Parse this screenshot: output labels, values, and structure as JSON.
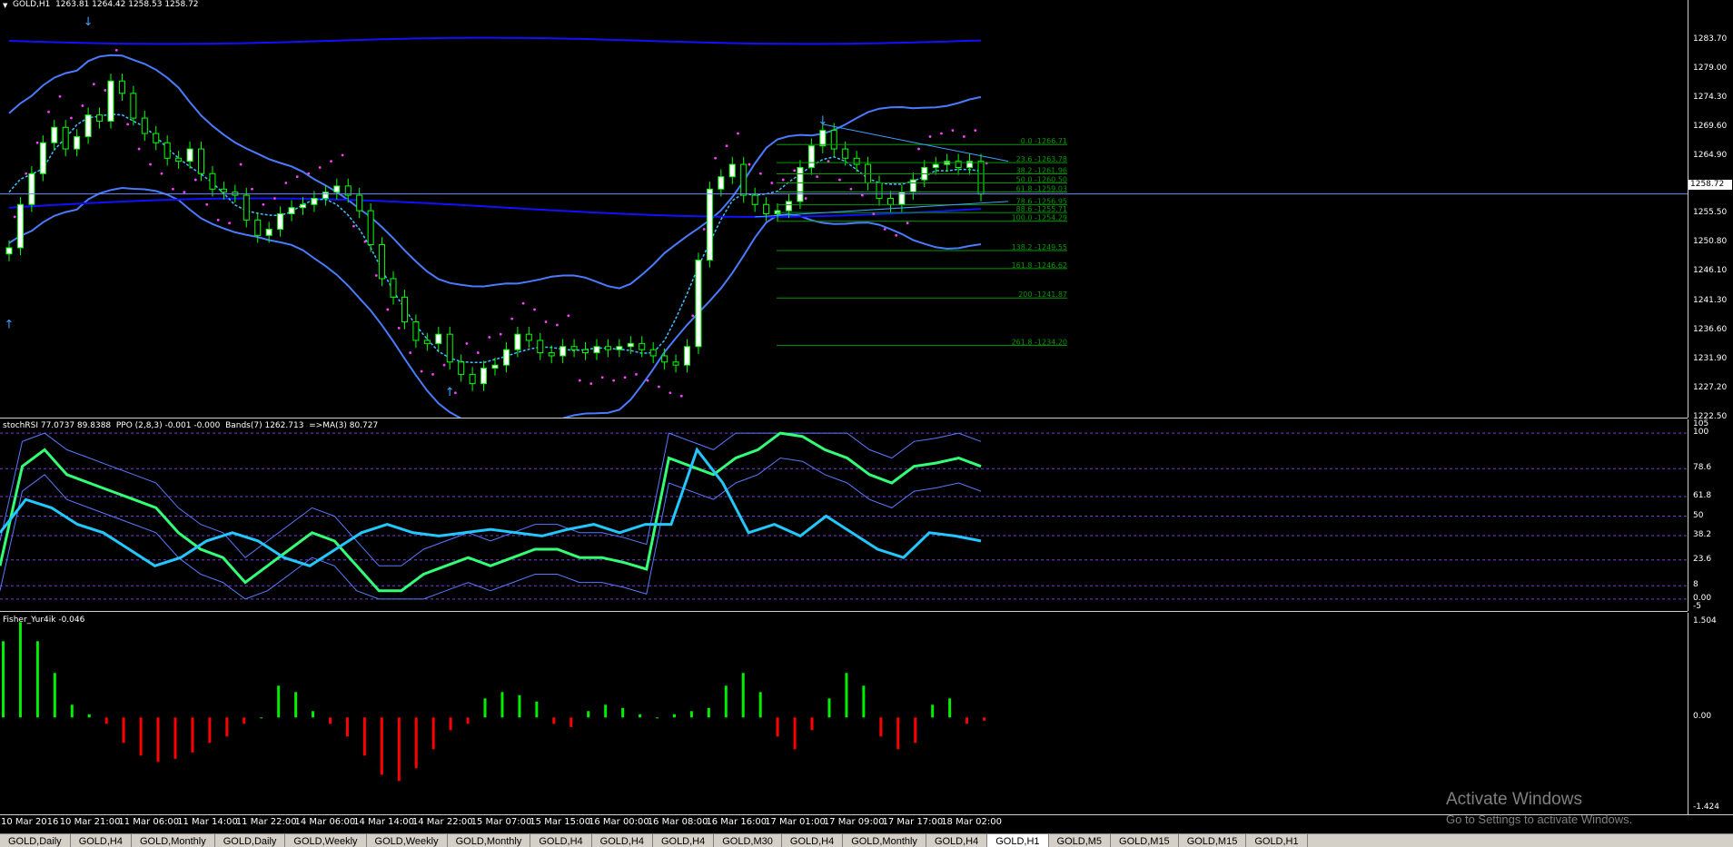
{
  "main_pane": {
    "label": "GOLD,H1  1263.81 1264.42 1258.53 1258.72",
    "price_tag": "1258.72",
    "ylim": [
      1222.5,
      1286.0
    ],
    "yticks": [
      "1283.70",
      "1279.00",
      "1274.30",
      "1269.60",
      "1264.90",
      "1260.20",
      "1255.50",
      "1250.80",
      "1246.10",
      "1241.30",
      "1236.60",
      "1231.90",
      "1227.20",
      "1222.50"
    ]
  },
  "stoch_pane": {
    "label": "stochRSI 77.0737 89.8388  PPO (2,8,3) -0.001 -0.000  Bands(7) 1262.713  =>MA(3) 80.727",
    "yticks": [
      "105",
      "100",
      "78.6",
      "61.8",
      "50",
      "38.2",
      "23.6",
      "8",
      "0.00",
      "-5"
    ]
  },
  "fisher_pane": {
    "label": "Fisher_Yur4ik -0.046",
    "yticks": [
      "1.504",
      "0.00",
      "-1.424"
    ]
  },
  "fib_levels": [
    {
      "label": "0.0 -1266.71",
      "value": 1266.71
    },
    {
      "label": "23.6 -1263.78",
      "value": 1263.78
    },
    {
      "label": "38.2 -1261.96",
      "value": 1261.96
    },
    {
      "label": "50.0 -1260.50",
      "value": 1260.5
    },
    {
      "label": "61.8 -1259.03",
      "value": 1259.03
    },
    {
      "label": "78.6 -1256.95",
      "value": 1256.95
    },
    {
      "label": "88.6 -1255.71",
      "value": 1255.71
    },
    {
      "label": "100.0 -1254.29",
      "value": 1254.29
    },
    {
      "label": "138.2 -1249.55",
      "value": 1249.55
    },
    {
      "label": "161.8 -1246.62",
      "value": 1246.62
    },
    {
      "label": "200 -1241.87",
      "value": 1241.87
    },
    {
      "label": "261.8 -1234.20",
      "value": 1234.2
    }
  ],
  "time_axis": [
    "10 Mar 2016",
    "10 Mar 21:00",
    "11 Mar 06:00",
    "11 Mar 14:00",
    "11 Mar 22:00",
    "14 Mar 06:00",
    "14 Mar 14:00",
    "14 Mar 22:00",
    "15 Mar 07:00",
    "15 Mar 15:00",
    "16 Mar 00:00",
    "16 Mar 08:00",
    "16 Mar 16:00",
    "17 Mar 01:00",
    "17 Mar 09:00",
    "17 Mar 17:00",
    "18 Mar 02:00"
  ],
  "tabs": [
    "GOLD,Daily",
    "GOLD,H4",
    "GOLD,Monthly",
    "GOLD,Daily",
    "GOLD,Weekly",
    "GOLD,Weekly",
    "GOLD,Monthly",
    "GOLD,H4",
    "GOLD,H4",
    "GOLD,H4",
    "GOLD,M30",
    "GOLD,H4",
    "GOLD,Monthly",
    "GOLD,H4",
    "GOLD,H1",
    "GOLD,M5",
    "GOLD,M15",
    "GOLD,M15",
    "GOLD,H1"
  ],
  "active_tab_index": 14,
  "watermark": {
    "title": "Activate Windows",
    "subtitle": "Go to Settings to activate Windows."
  },
  "colors": {
    "bull_candle": "#ffffff",
    "bear_candle": "#000000",
    "wick": "#00ff00",
    "bands": "#4a7bff",
    "band_mid": "#1010ff",
    "sar": "#ff40ff",
    "ma_fast": "#44c0ff",
    "fib": "#009900",
    "trend": "#40a0ff",
    "stoch_green": "#33ff77",
    "stoch_cyan": "#22c8ff",
    "fisher_up": "#00ee00",
    "fisher_down": "#ff0000",
    "dotted_level": "#7a3bd8"
  },
  "chart_data": {
    "type": "line",
    "title": "GOLD,H1",
    "close": [
      1250.0,
      1257.0,
      1262.0,
      1267.0,
      1269.5,
      1266.0,
      1268.0,
      1271.5,
      1270.5,
      1277.0,
      1275.0,
      1271.0,
      1268.5,
      1267.0,
      1264.5,
      1264.0,
      1266.0,
      1262.0,
      1259.5,
      1259.0,
      1258.5,
      1254.5,
      1252.0,
      1253.0,
      1255.5,
      1256.5,
      1257.0,
      1258.0,
      1259.0,
      1260.0,
      1258.5,
      1256.0,
      1250.5,
      1245.0,
      1242.0,
      1238.0,
      1235.0,
      1234.5,
      1236.0,
      1231.5,
      1229.5,
      1228.0,
      1230.5,
      1231.0,
      1233.5,
      1236.0,
      1235.0,
      1233.0,
      1232.5,
      1234.0,
      1233.5,
      1233.0,
      1234.0,
      1233.5,
      1234.0,
      1234.5,
      1233.5,
      1232.5,
      1231.5,
      1231.0,
      1234.0,
      1248.0,
      1259.5,
      1261.5,
      1263.5,
      1258.5,
      1257.0,
      1255.5,
      1256.0,
      1257.5,
      1263.0,
      1266.5,
      1269.0,
      1266.0,
      1264.5,
      1263.5,
      1260.5,
      1258.0,
      1257.0,
      1259.0,
      1261.0,
      1263.0,
      1263.5,
      1264.0,
      1263.0,
      1264.0,
      1258.7
    ],
    "stoch_rsi": [
      20,
      80,
      90,
      75,
      70,
      65,
      60,
      55,
      40,
      30,
      25,
      10,
      20,
      30,
      40,
      35,
      20,
      5,
      5,
      15,
      20,
      25,
      20,
      25,
      30,
      30,
      25,
      25,
      22,
      18,
      85,
      80,
      75,
      85,
      90,
      100,
      98,
      90,
      85,
      75,
      70,
      80,
      82,
      85,
      80
    ],
    "ppo_line": [
      40,
      60,
      55,
      45,
      40,
      30,
      20,
      25,
      35,
      40,
      35,
      25,
      20,
      30,
      40,
      45,
      40,
      38,
      40,
      42,
      40,
      38,
      42,
      45,
      40,
      45,
      45,
      90,
      70,
      40,
      45,
      38,
      50,
      40,
      30,
      25,
      40,
      38,
      35
    ],
    "fisher": [
      1.2,
      1.5,
      1.2,
      0.7,
      0.2,
      0.05,
      -0.1,
      -0.4,
      -0.6,
      -0.7,
      -0.65,
      -0.55,
      -0.4,
      -0.3,
      -0.1,
      0.0,
      0.5,
      0.4,
      0.1,
      -0.1,
      -0.3,
      -0.6,
      -0.9,
      -1.0,
      -0.8,
      -0.5,
      -0.2,
      -0.1,
      0.3,
      0.4,
      0.35,
      0.25,
      -0.1,
      -0.15,
      0.1,
      0.2,
      0.15,
      0.05,
      0.0,
      0.05,
      0.1,
      0.15,
      0.5,
      0.7,
      0.4,
      -0.3,
      -0.5,
      -0.2,
      0.3,
      0.7,
      0.5,
      -0.3,
      -0.5,
      -0.4,
      0.2,
      0.3,
      -0.1,
      -0.05
    ],
    "ylim": [
      1222.5,
      1286.0
    ],
    "xlabel": "",
    "ylabel": ""
  }
}
